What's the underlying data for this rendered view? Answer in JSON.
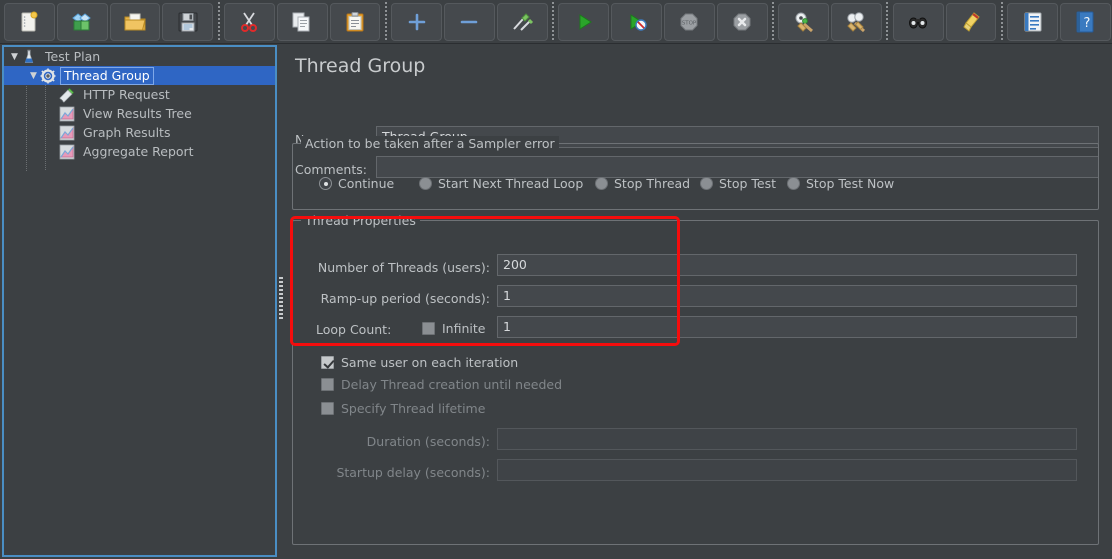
{
  "toolbar": {
    "items": [
      {
        "name": "new-icon",
        "label": "New",
        "glyph": "new"
      },
      {
        "name": "templates-icon",
        "label": "Templates",
        "glyph": "templates"
      },
      {
        "name": "open-icon",
        "label": "Open",
        "glyph": "open"
      },
      {
        "name": "save-icon",
        "label": "Save Test Plan",
        "glyph": "save"
      },
      {
        "name": "separator",
        "label": "",
        "glyph": "sep"
      },
      {
        "name": "cut-icon",
        "label": "Cut",
        "glyph": "cut"
      },
      {
        "name": "copy-icon",
        "label": "Copy",
        "glyph": "copy"
      },
      {
        "name": "paste-icon",
        "label": "Paste",
        "glyph": "paste"
      },
      {
        "name": "separator",
        "label": "",
        "glyph": "sep"
      },
      {
        "name": "expand-all-icon",
        "label": "Expand All",
        "glyph": "plus"
      },
      {
        "name": "collapse-all-icon",
        "label": "Collapse All",
        "glyph": "minus"
      },
      {
        "name": "toggle-icon",
        "label": "Toggle",
        "glyph": "toggle"
      },
      {
        "name": "separator",
        "label": "",
        "glyph": "sep"
      },
      {
        "name": "start-icon",
        "label": "Start",
        "glyph": "start"
      },
      {
        "name": "start-no-pauses-icon",
        "label": "Start no pauses",
        "glyph": "start-no-pause"
      },
      {
        "name": "stop-icon",
        "label": "Stop",
        "glyph": "stop"
      },
      {
        "name": "shutdown-icon",
        "label": "Shutdown",
        "glyph": "shutdown"
      },
      {
        "name": "separator",
        "label": "",
        "glyph": "sep"
      },
      {
        "name": "clear-icon",
        "label": "Clear",
        "glyph": "clear"
      },
      {
        "name": "clear-all-icon",
        "label": "Clear All",
        "glyph": "clear-all"
      },
      {
        "name": "separator",
        "label": "",
        "glyph": "sep"
      },
      {
        "name": "search-icon",
        "label": "Search",
        "glyph": "search"
      },
      {
        "name": "reset-search-icon",
        "label": "Reset Search",
        "glyph": "reset-search"
      },
      {
        "name": "separator",
        "label": "",
        "glyph": "sep"
      },
      {
        "name": "function-helper-icon",
        "label": "Function Helper Dialog",
        "glyph": "functions"
      },
      {
        "name": "help-icon",
        "label": "Help",
        "glyph": "help"
      }
    ]
  },
  "tree": {
    "nodes": [
      {
        "label": "Test Plan",
        "icon": "test-plan-icon",
        "depth": 0,
        "twisty": "▼",
        "selected": false
      },
      {
        "label": "Thread Group",
        "icon": "thread-group-icon",
        "depth": 1,
        "twisty": "▼",
        "selected": true
      },
      {
        "label": "HTTP Request",
        "icon": "http-request-icon",
        "depth": 2,
        "twisty": "",
        "selected": false
      },
      {
        "label": "View Results Tree",
        "icon": "listener-icon",
        "depth": 2,
        "twisty": "",
        "selected": false
      },
      {
        "label": "Graph Results",
        "icon": "listener-icon",
        "depth": 2,
        "twisty": "",
        "selected": false
      },
      {
        "label": "Aggregate Report",
        "icon": "listener-icon",
        "depth": 2,
        "twisty": "",
        "selected": false
      }
    ]
  },
  "panel": {
    "title": "Thread Group",
    "name_label": "Name:",
    "name_value": "Thread Group",
    "comments_label": "Comments:",
    "comments_value": "",
    "error_action": {
      "title": "Action to be taken after a Sampler error",
      "options": [
        {
          "label": "Continue",
          "selected": true
        },
        {
          "label": "Start Next Thread Loop",
          "selected": false
        },
        {
          "label": "Stop Thread",
          "selected": false
        },
        {
          "label": "Stop Test",
          "selected": false
        },
        {
          "label": "Stop Test Now",
          "selected": false
        }
      ]
    },
    "thread_properties": {
      "title": "Thread Properties",
      "num_threads_label": "Number of Threads (users):",
      "num_threads_value": "200",
      "ramp_up_label": "Ramp-up period (seconds):",
      "ramp_up_value": "1",
      "loop_count_label": "Loop Count:",
      "infinite_label": "Infinite",
      "infinite_checked": false,
      "loop_count_value": "1",
      "same_user_label": "Same user on each iteration",
      "same_user_checked": true,
      "delay_thread_label": "Delay Thread creation until needed",
      "delay_thread_checked": false,
      "specify_lifetime_label": "Specify Thread lifetime",
      "specify_lifetime_checked": false,
      "duration_label": "Duration (seconds):",
      "duration_value": "",
      "startup_delay_label": "Startup delay (seconds):",
      "startup_delay_value": ""
    }
  },
  "annotation": {
    "highlight_color": "#f50d0d",
    "highlight_target": "Thread Properties"
  },
  "colors": {
    "background": "#3c4043",
    "field_bg": "#44484c",
    "selection": "#2f66c4",
    "focus_border": "#4a8ec4",
    "text": "#bdc1c4",
    "text_dim": "#81868a"
  }
}
